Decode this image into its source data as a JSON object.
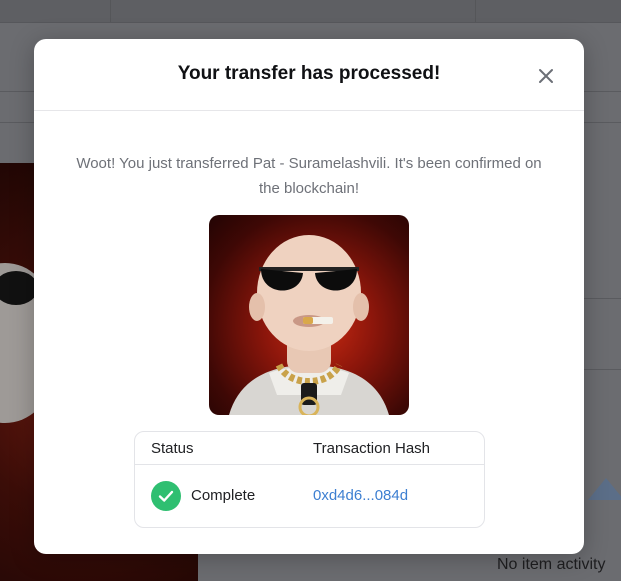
{
  "background": {
    "empty_activity_text": "No item activity"
  },
  "modal": {
    "title": "Your transfer has processed!",
    "close_icon": "close-icon",
    "message": "Woot! You just transferred Pat - Suramelashvili. It's been confirmed on the blockchain!",
    "nft_image_icon": "nft-avatar-image",
    "status_table": {
      "headers": [
        "Status",
        "Transaction Hash"
      ],
      "status_value": "Complete",
      "status_icon": "check-circle-icon",
      "transaction_hash": "0xd4d6...084d"
    }
  },
  "colors": {
    "success": "#2fbf71",
    "link": "#3d7fd1",
    "overlay": "#6b6c70"
  }
}
